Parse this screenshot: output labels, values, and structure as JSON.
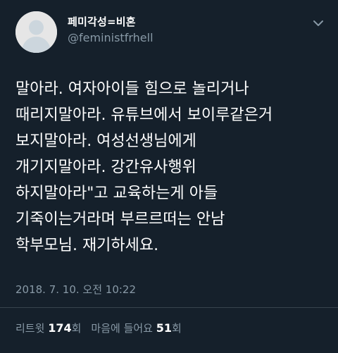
{
  "account": {
    "display_name": "페미각성=비혼",
    "handle": "@feministfrhell"
  },
  "tweet": {
    "lines": [
      "말아라. 여자아이들 힘으로 놀리거나",
      "때리지말아라. 유튜브에서 보이루같은거",
      "보지말아라. 여성선생님에게",
      "개기지말아라. 강간유사행위",
      "하지말아라\"고 교육하는게 아들",
      "기죽이는거라며 부르르떠는 안남",
      "학부모님. 재기하세요."
    ],
    "timestamp": "2018. 7. 10. 오전 10:22"
  },
  "stats": {
    "retweet_label": "리트윗",
    "retweet_count": "174",
    "retweet_unit": "회",
    "like_label": "마음에 들어요",
    "like_count": "51",
    "like_unit": "회"
  },
  "icons": {
    "avatar": "default-avatar-icon",
    "menu": "chevron-down-icon"
  },
  "colors": {
    "background": "#15202b",
    "text": "#ffffff",
    "secondary_text": "#8899a6",
    "divider": "#38444d"
  }
}
